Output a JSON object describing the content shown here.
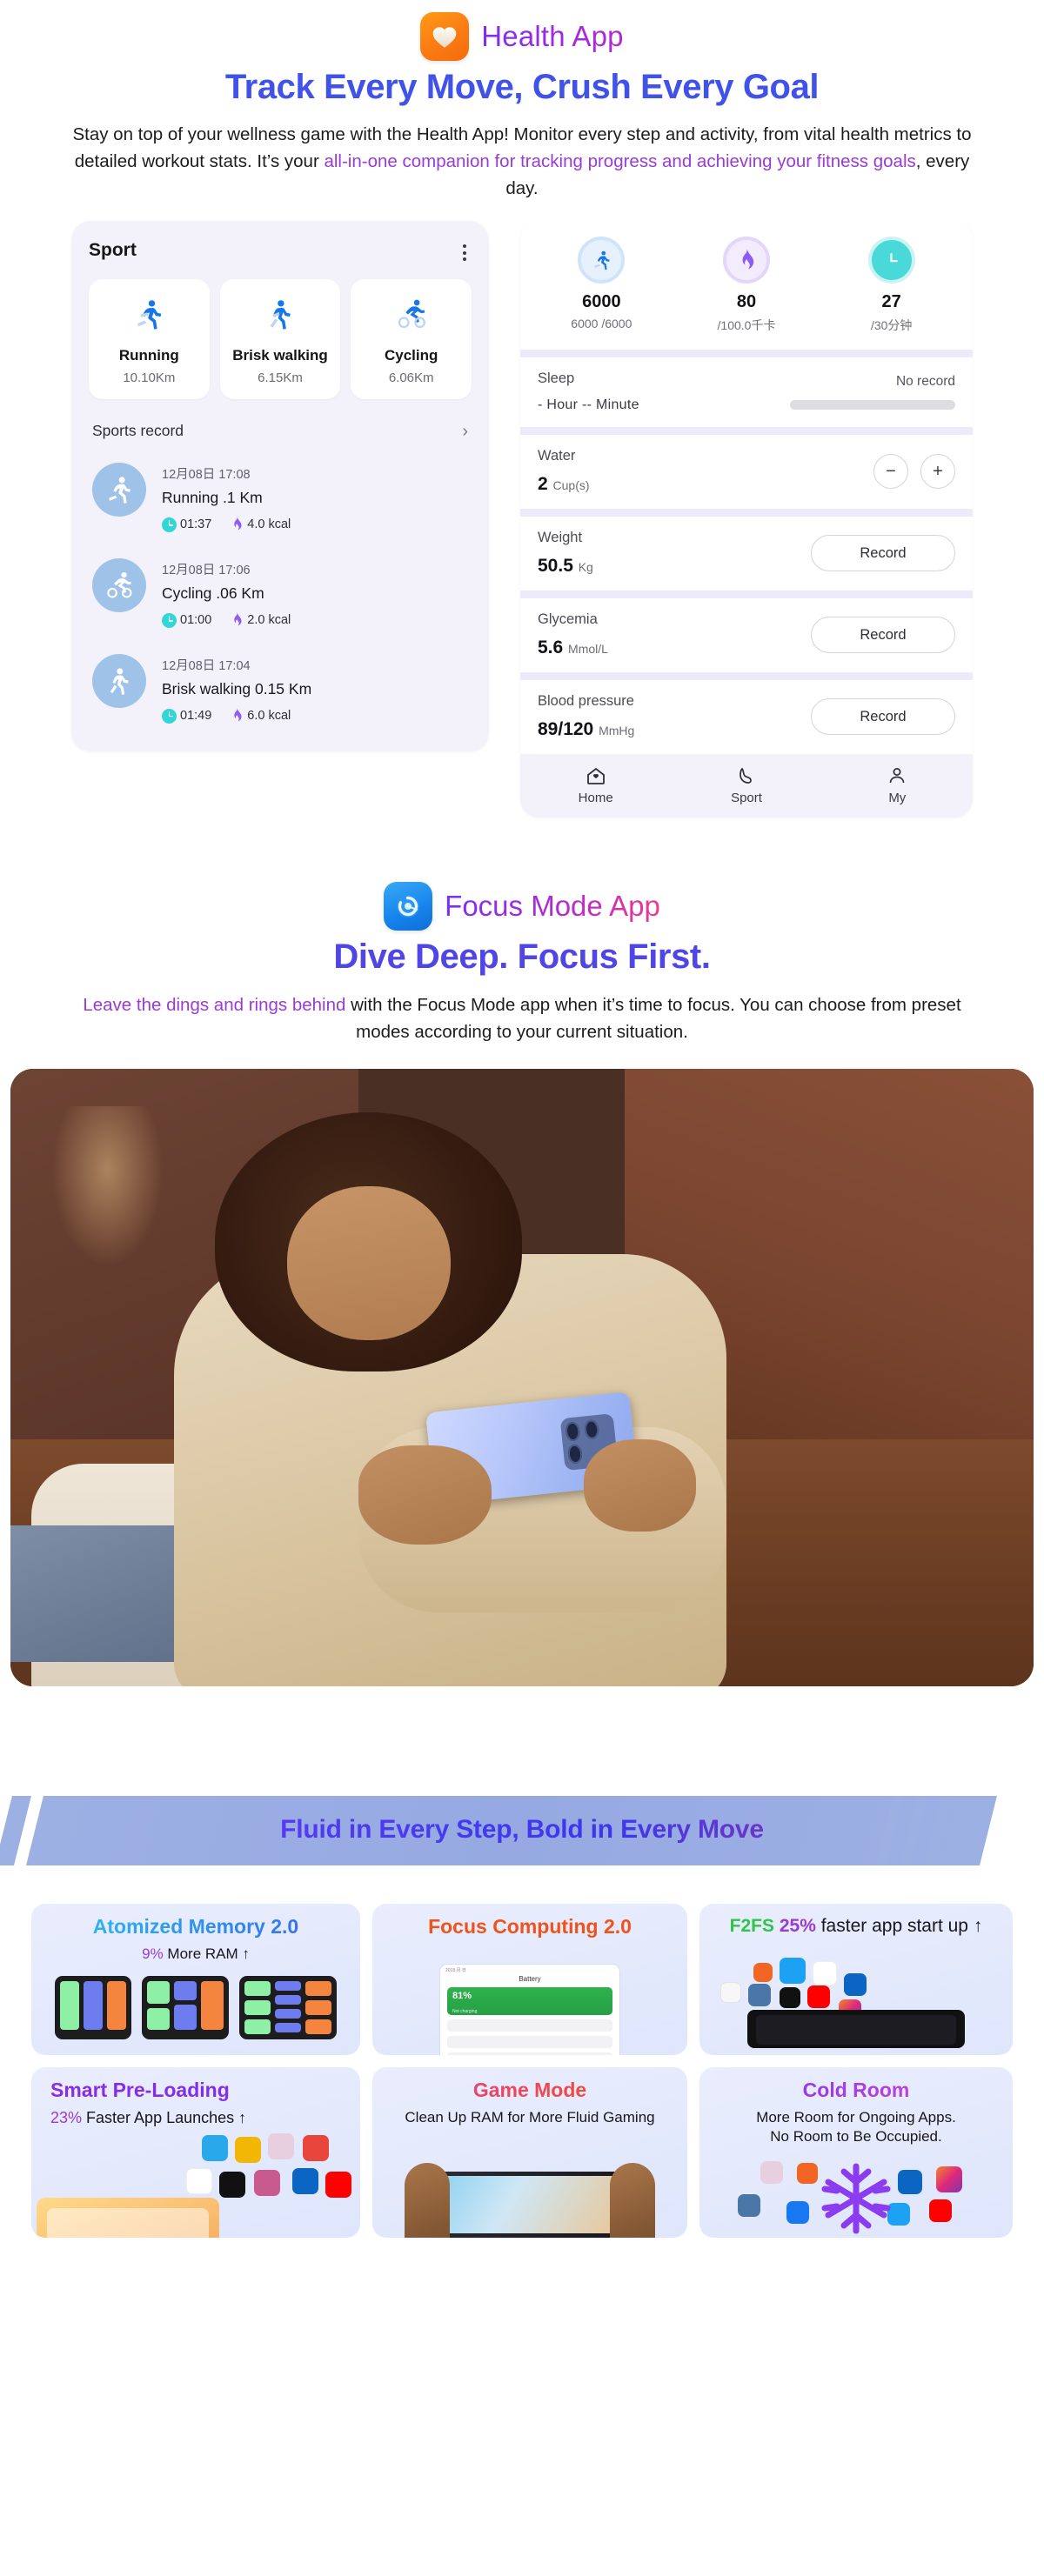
{
  "health": {
    "app_name": "Health App",
    "app_icon": "heart-icon",
    "headline": "Track Every Move, Crush Every Goal",
    "lede_part1": "Stay on top of your wellness game with the Health App! Monitor every step and activity, from vital health metrics to detailed workout stats. It’s your ",
    "lede_highlight": "all-in-one companion for tracking progress and achieving your fitness goals",
    "lede_part2": ", every day.",
    "sport_card": {
      "title": "Sport",
      "menu_icon": "kebab-menu-icon",
      "tiles": [
        {
          "icon": "running-icon",
          "name": "Running",
          "distance": "10.10Km"
        },
        {
          "icon": "walking-icon",
          "name": "Brisk walking",
          "distance": "6.15Km"
        },
        {
          "icon": "cycling-icon",
          "name": "Cycling",
          "distance": "6.06Km"
        }
      ],
      "records_label": "Sports record",
      "records_chevron": "›",
      "records": [
        {
          "icon": "running-icon",
          "date": "12月08日 17:08",
          "name": "Running   .1 Km",
          "duration": "01:37",
          "calories": "4.0 kcal"
        },
        {
          "icon": "cycling-icon",
          "date": "12月08日 17:06",
          "name": "Cycling   .06 Km",
          "duration": "01:00",
          "calories": "2.0 kcal"
        },
        {
          "icon": "walking-icon",
          "date": "12月08日 17:04",
          "name": "Brisk walking 0.15 Km",
          "duration": "01:49",
          "calories": "6.0 kcal"
        }
      ]
    },
    "dashboard": {
      "rings": [
        {
          "icon": "steps-icon",
          "value": "6000",
          "goal": "6000 /6000"
        },
        {
          "icon": "flame-icon",
          "value": "80",
          "goal": "/100.0千卡"
        },
        {
          "icon": "clock-icon",
          "value": "27",
          "goal": "/30分钟"
        }
      ],
      "sleep": {
        "label": "Sleep",
        "duration": "- Hour -- Minute",
        "status": "No record"
      },
      "water": {
        "label": "Water",
        "value": "2",
        "unit": "Cup(s)",
        "minus": "−",
        "plus": "+"
      },
      "weight": {
        "label": "Weight",
        "value": "50.5",
        "unit": "Kg",
        "button": "Record"
      },
      "glycemia": {
        "label": "Glycemia",
        "value": "5.6",
        "unit": "Mmol/L",
        "button": "Record"
      },
      "blood_pressure": {
        "label": "Blood pressure",
        "value": "89/120",
        "unit": "MmHg",
        "button": "Record"
      },
      "tabs": [
        {
          "icon": "home-icon",
          "label": "Home"
        },
        {
          "icon": "shoe-icon",
          "label": "Sport"
        },
        {
          "icon": "person-icon",
          "label": "My"
        }
      ]
    }
  },
  "focus": {
    "app_name": "Focus Mode App",
    "app_icon": "focus-dial-icon",
    "headline": "Dive Deep. Focus First.",
    "lede_highlight": "Leave the dings and rings behind",
    "lede_rest": " with the Focus Mode app when it’s time to focus. You can choose from preset modes according to your current situation.",
    "photo_alt": "woman-holding-phone-photo"
  },
  "banner": {
    "text": "Fluid in Every Step, Bold in Every Move"
  },
  "features": [
    {
      "title": "Atomized Memory 2.0",
      "sub_pct": "9%",
      "sub_rest": " More RAM ↑",
      "art": "memory-blocks"
    },
    {
      "title": "Focus Computing 2.0",
      "sub": "",
      "art": "battery-screenshot",
      "screenshot": {
        "status": "2018 月 日",
        "back": "‹",
        "title": "Battery",
        "percent": "81%",
        "note": "Not charging"
      }
    },
    {
      "title_pre": "F2FS",
      "title_pct": "25%",
      "title_rest": " faster app start up ↑",
      "art": "app-icon-cloud"
    },
    {
      "title": "Smart Pre-Loading",
      "sub_pct": "23%",
      "sub_rest": " Faster App Launches ↑",
      "art": "app-icon-cloud-phone"
    },
    {
      "title": "Game Mode",
      "sub": "Clean Up RAM for More Fluid Gaming",
      "art": "gaming-hands"
    },
    {
      "title": "Cold Room",
      "sub": "More Room for Ongoing Apps.\nNo Room to Be Occupied.",
      "art": "snowflake-apps"
    }
  ],
  "colors": {
    "headline_blue": "#4052e8",
    "accent_purple": "#9a3bd4",
    "orange": "#f0531a",
    "green": "#2fc44a",
    "banner_bg": "#9db0e4"
  }
}
